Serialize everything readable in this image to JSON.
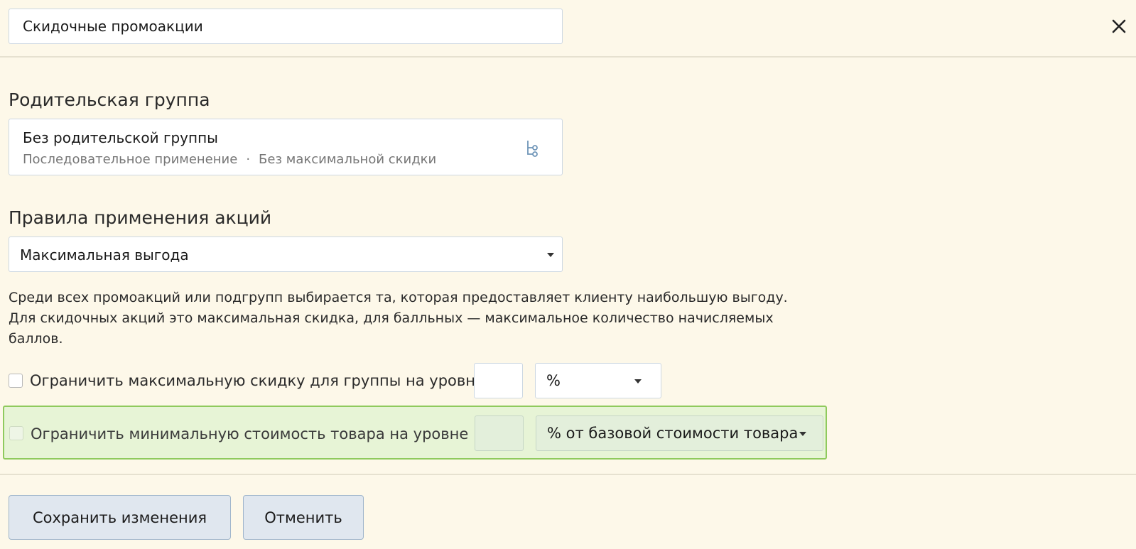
{
  "header": {
    "name_value": "Скидочные промоакции",
    "close_icon": "close-icon"
  },
  "parent_group": {
    "label": "Родительская группа",
    "title": "Без родительской группы",
    "mode": "Последовательное применение",
    "separator": "·",
    "max_discount": "Без максимальной скидки",
    "icon": "tree-structure-icon"
  },
  "rules": {
    "label": "Правила применения акций",
    "selected": "Максимальная выгода",
    "description_lines": [
      "Среди всех промоакций или подгрупп выбирается та, которая предоставляет клиенту наибольшую выгоду.",
      "Для скидочных акций это максимальная скидка, для балльных — максимальное количество начисляемых",
      "баллов."
    ]
  },
  "limits": {
    "discount": {
      "label": "Ограничить максимальную скидку для группы на уровне",
      "checked": false,
      "value": "",
      "unit": "%"
    },
    "min_price": {
      "label": "Ограничить минимальную стоимость товара на уровне",
      "checked": false,
      "value": "",
      "unit": "% от базовой стоимости товара",
      "highlight_color": "#8fca5d"
    }
  },
  "footer": {
    "save_label": "Сохранить изменения",
    "cancel_label": "Отменить"
  }
}
